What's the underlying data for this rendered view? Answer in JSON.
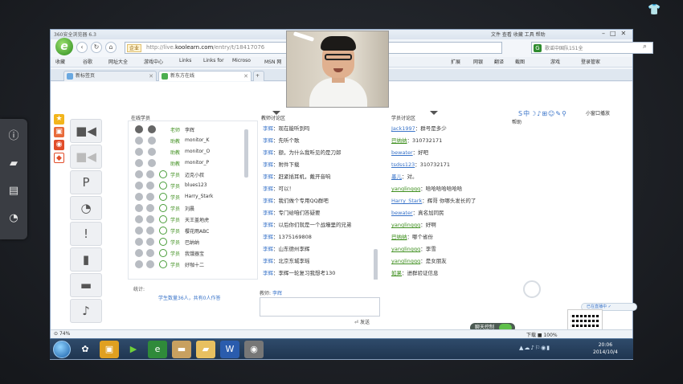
{
  "browser": {
    "title": "360安全浏览器 6.3",
    "menu": "文件  查看  收藏  工具  帮助",
    "url_prefix": "http://live.",
    "url_domain": "koolearn.com",
    "url_rest": "/entry/t/18417076",
    "addr_tag": "企业",
    "search_placeholder": "歌谣中国队151全",
    "bookmarks": [
      "收藏",
      "谷歌",
      "网址大全",
      "游戏中心",
      "Links",
      "Links for",
      "Microso",
      "MSN 网"
    ],
    "bm_right": [
      "扩展",
      "网银",
      "翻译",
      "截图",
      "游戏",
      "登录管家"
    ],
    "tabs": [
      {
        "label": "新标签页"
      },
      {
        "label": "新东方在线"
      }
    ],
    "zoom": "74%",
    "status_right": "下载   ■   100%"
  },
  "page": {
    "help": "帮助",
    "mini_play": "小窗口播放",
    "float_pill": "已在直播中 ✓",
    "students_title": "在线学员",
    "teacher_title": "教师讨论区",
    "student_disc_title": "学员讨论区",
    "students_footer_label": "统计:",
    "students_count": "学生数量36人，共有0人作答",
    "input_label": "教师:",
    "input_user": "李辉",
    "send_label": "发送",
    "chat_control": "聊天控制",
    "students": [
      {
        "role": "老师",
        "name": "李辉",
        "dot": "dark"
      },
      {
        "role": "助教",
        "name": "monitor_K",
        "dot": "grey"
      },
      {
        "role": "助教",
        "name": "monitor_O",
        "dot": "grey"
      },
      {
        "role": "助教",
        "name": "monitor_P",
        "dot": "grey"
      },
      {
        "role": "学员",
        "name": "迈克小叔",
        "dot": "green"
      },
      {
        "role": "学员",
        "name": "blues123",
        "dot": "green"
      },
      {
        "role": "学员",
        "name": "Harry_Stark",
        "dot": "green"
      },
      {
        "role": "学员",
        "name": "刘晨",
        "dot": "green"
      },
      {
        "role": "学员",
        "name": "天王盖地虎",
        "dot": "green"
      },
      {
        "role": "学员",
        "name": "樱花雨ABC",
        "dot": "green"
      },
      {
        "role": "学员",
        "name": "巴纳纳",
        "dot": "green"
      },
      {
        "role": "学员",
        "name": "我饿器宝",
        "dot": "green"
      },
      {
        "role": "学员",
        "name": "好咖十二",
        "dot": "green"
      }
    ],
    "teacher_msgs": [
      {
        "who": "李辉",
        "text": "：现在能听到吗"
      },
      {
        "who": "李辉",
        "text": "：先听个歌"
      },
      {
        "who": "李辉",
        "text": "：额，为什么我听见的是刀郎"
      },
      {
        "who": "李辉",
        "text": "：附件下载"
      },
      {
        "who": "李辉",
        "text": "：赶紧插耳机，戴开音响"
      },
      {
        "who": "李辉",
        "text": "：可以！"
      },
      {
        "who": "李辉",
        "text": "：我们做个专用QQ群吧"
      },
      {
        "who": "李辉",
        "text": "：专门给咱们答疑要"
      },
      {
        "who": "李辉",
        "text": "：以后你们就是一个战壕里的兄弟"
      },
      {
        "who": "李辉",
        "text": "：1375169808"
      },
      {
        "who": "李辉",
        "text": "：山东德州李辉"
      },
      {
        "who": "李辉",
        "text": "：北京东城李瑶"
      },
      {
        "who": "李辉",
        "text": "：李辉一轮复习我想考130"
      }
    ],
    "student_msgs": [
      {
        "who": "Jack1997",
        "text": "：群号是多少"
      },
      {
        "who": "巴纳纳",
        "text": "：310732171"
      },
      {
        "who": "bewater",
        "text": "：好吧"
      },
      {
        "who": "tsdss123",
        "text": "：310732171"
      },
      {
        "who": "墨儿",
        "text": "：对。"
      },
      {
        "who": "yanglingqq",
        "text": "：哈哈哈哈哈哈哈"
      },
      {
        "who": "Harry_Stark",
        "text": "：辉哥 你哪头发长的了"
      },
      {
        "who": "bewater",
        "text": "：真名加同民"
      },
      {
        "who": "yanglingqq",
        "text": "：好啊"
      },
      {
        "who": "巴纳纳",
        "text": "：哪个省份"
      },
      {
        "who": "yanglingqq",
        "text": "：李雪"
      },
      {
        "who": "yanglingqq",
        "text": "：是女朋友"
      },
      {
        "who": "如果",
        "text": "：进群验证信息"
      }
    ]
  },
  "taskbar": {
    "time": "20:06",
    "date": "2014/10/4"
  },
  "colors": {
    "link": "#3a74c9",
    "role": "#3f8f1f",
    "taskbar": "#1f3550"
  }
}
